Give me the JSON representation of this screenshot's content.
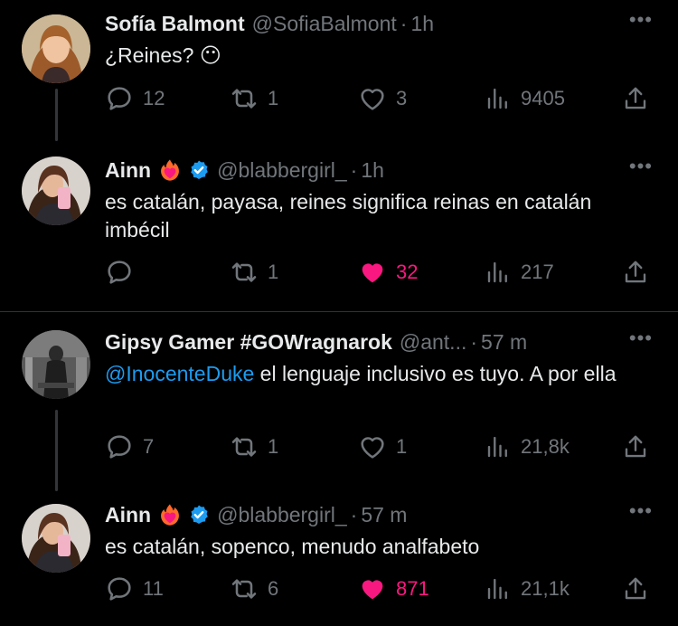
{
  "tweets": [
    {
      "name": "Sofía Balmont",
      "handle": "@SofiaBalmont",
      "time": "1h",
      "text": "¿Reines? 😶",
      "replies": "12",
      "retweets": "1",
      "likes": "3",
      "views": "9405",
      "liked": false,
      "verified": false
    },
    {
      "name": "Ainn",
      "handle": "@blabbergirl_",
      "time": "1h",
      "text": "es catalán, payasa, reines significa reinas en catalán imbécil",
      "replies": "",
      "retweets": "1",
      "likes": "32",
      "views": "217",
      "liked": true,
      "verified": true
    },
    {
      "name": "Gipsy Gamer #GOWragnarok",
      "handle": "@ant...",
      "time": "57 m",
      "mention": "@InocenteDuke",
      "text": " el lenguaje inclusivo es tuyo. A por ella",
      "replies": "7",
      "retweets": "1",
      "likes": "1",
      "views": "21,8k",
      "liked": false,
      "verified": false
    },
    {
      "name": "Ainn",
      "handle": "@blabbergirl_",
      "time": "57 m",
      "text": "es catalán, sopenco, menudo analfabeto",
      "replies": "11",
      "retweets": "6",
      "likes": "871",
      "views": "21,1k",
      "liked": true,
      "verified": true
    }
  ],
  "colors": {
    "background": "#000000",
    "text": "#e7e9ea",
    "muted": "#71767b",
    "accent": "#1d9bf0",
    "like": "#f91880"
  },
  "icons": [
    "reply-icon",
    "retweet-icon",
    "like-icon",
    "views-icon",
    "share-icon",
    "more-icon",
    "verified-icon",
    "heart-on-fire-emoji"
  ]
}
